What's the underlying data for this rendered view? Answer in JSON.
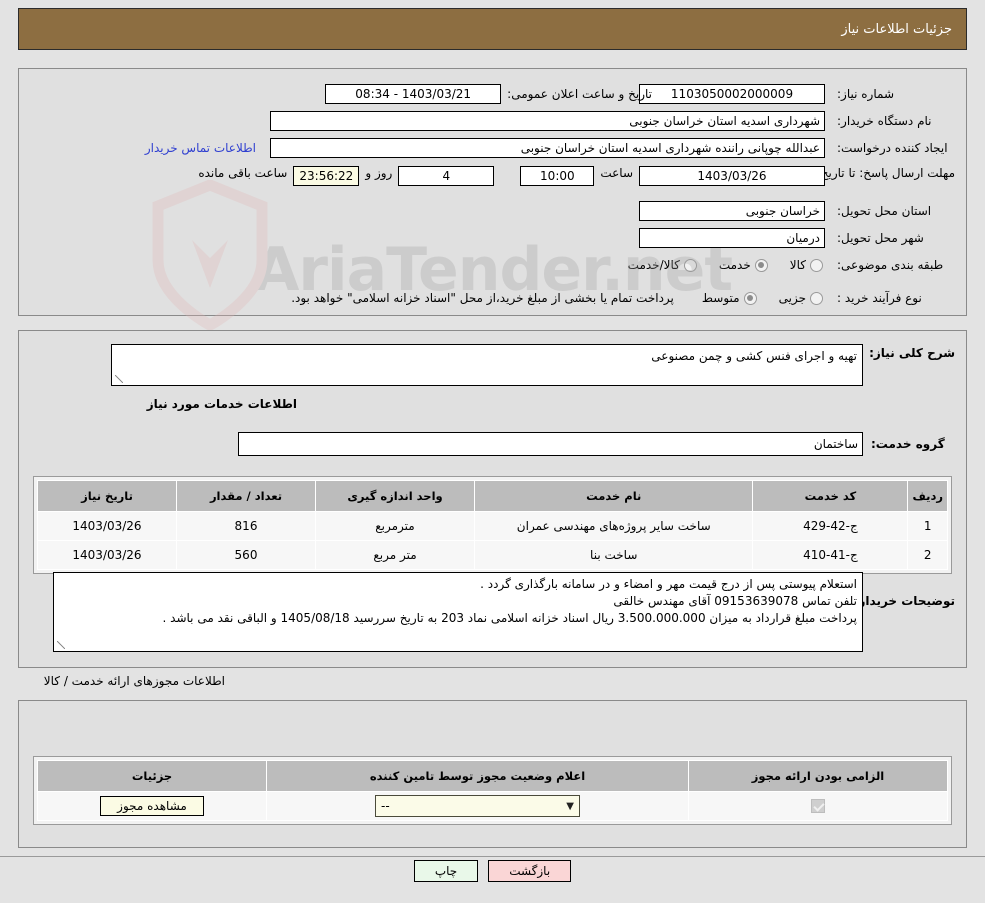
{
  "header": {
    "title": "جزئیات اطلاعات نیاز"
  },
  "watermark": {
    "text": "AriaTender.net"
  },
  "fields": {
    "need_number_label": "شماره نیاز:",
    "need_number_value": "1103050002000009",
    "announce_label": "تاریخ و ساعت اعلان عمومی:",
    "announce_value": "1403/03/21 - 08:34",
    "buyer_org_label": "نام دستگاه خریدار:",
    "buyer_org_value": "شهرداری اسدیه استان خراسان جنوبی",
    "creator_label": "ایجاد کننده درخواست:",
    "creator_value": "عبدالله چوپانی راننده شهرداری اسدیه استان خراسان جنوبی",
    "contact_link": "اطلاعات تماس خریدار",
    "deadline_label": "مهلت ارسال پاسخ: تا تاریخ:",
    "deadline_date": "1403/03/26",
    "deadline_hour_label": "ساعت",
    "deadline_hour": "10:00",
    "days_value": "4",
    "days_label": "روز و",
    "countdown": "23:56:22",
    "countdown_label": "ساعت باقی مانده",
    "province_label": "استان محل تحویل:",
    "province_value": "خراسان جنوبی",
    "city_label": "شهر محل تحویل:",
    "city_value": "درمیان",
    "category_label": "طبقه بندی موضوعی:",
    "process_label": "نوع فرآیند خرید :",
    "process_note": "پرداخت تمام یا بخشی از مبلغ خرید،از محل \"اسناد خزانه اسلامی\" خواهد بود."
  },
  "category_options": [
    {
      "label": "کالا",
      "selected": false
    },
    {
      "label": "خدمت",
      "selected": true
    },
    {
      "label": "کالا/خدمت",
      "selected": false
    }
  ],
  "process_options": [
    {
      "label": "جزیی",
      "selected": false
    },
    {
      "label": "متوسط",
      "selected": true
    }
  ],
  "description": {
    "label": "شرح کلی نیاز:",
    "value": "تهیه و اجرای فنس کشی و چمن مصنوعی",
    "services_heading": "اطلاعات خدمات مورد نیاز",
    "service_group_label": "گروه خدمت:",
    "service_group_value": "ساختمان"
  },
  "services_table": {
    "columns": [
      "ردیف",
      "کد خدمت",
      "نام خدمت",
      "واحد اندازه گیری",
      "تعداد / مقدار",
      "تاریخ نیاز"
    ],
    "rows": [
      {
        "row": "1",
        "code": "ج-42-429",
        "name": "ساخت سایر پروژه‌های مهندسی عمران",
        "unit": "مترمربع",
        "qty": "816",
        "date": "1403/03/26"
      },
      {
        "row": "2",
        "code": "ج-41-410",
        "name": "ساخت بنا",
        "unit": "متر مربع",
        "qty": "560",
        "date": "1403/03/26"
      }
    ]
  },
  "buyer_notes": {
    "label": "توضیحات خریدار:",
    "lines": [
      "استعلام پیوستی  پس از درج قیمت مهر و امضاء و در سامانه بارگذاری گردد .",
      "تلفن تماس 09153639078 آقای مهندس خالقی",
      "پرداخت مبلغ قرارداد به میزان 3.500.000.000 ریال اسناد خزانه اسلامی نماد 203 به تاریخ سررسید 1405/08/18 و الباقی نقد می باشد ."
    ]
  },
  "permits": {
    "heading": "اطلاعات مجوزهای ارائه خدمت / کالا",
    "columns": [
      "الزامی بودن ارائه مجوز",
      "اعلام وضعیت مجوز توسط تامین کننده",
      "جزئیات"
    ],
    "rows": [
      {
        "required_checked": true,
        "status_value": "--",
        "details_button": "مشاهده مجوز"
      }
    ]
  },
  "footer": {
    "print_label": "چاپ",
    "back_label": "بازگشت"
  },
  "colors": {
    "header_bg": "#8d6e41",
    "link": "#2f3fd0",
    "back_btn": "#fad6d6",
    "print_btn": "#e9f8e9",
    "khaki_field": "#fbfbe4"
  }
}
